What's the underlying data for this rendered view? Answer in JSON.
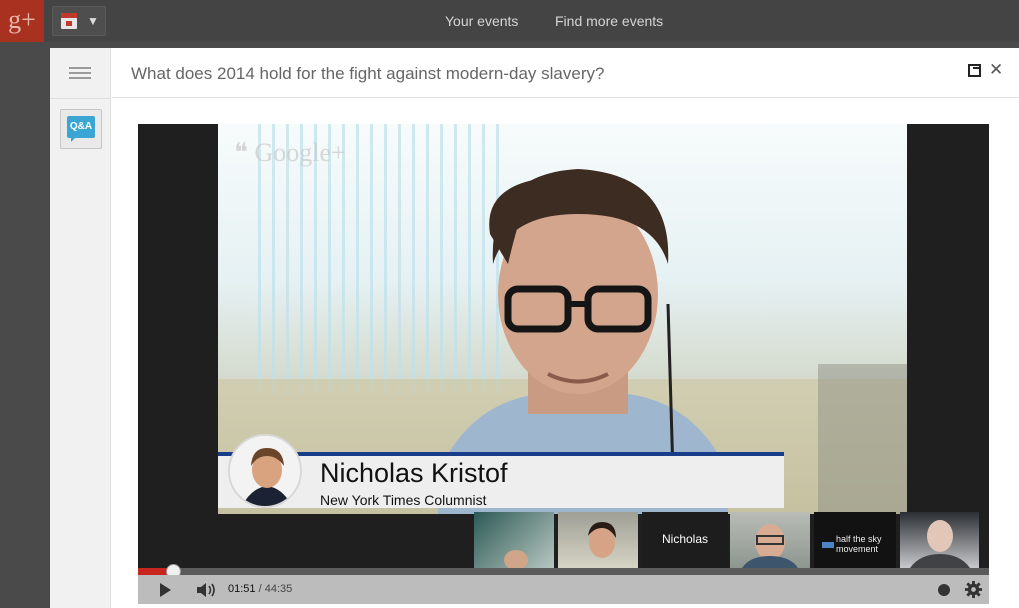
{
  "topbar": {
    "logo_text": "g+",
    "nav": [
      "Your events",
      "Find more events"
    ]
  },
  "modal": {
    "title": "What does 2014 hold for the fight against modern-day slavery?",
    "qa_label": "Q&A"
  },
  "video": {
    "watermark": "Google+",
    "lower_third": {
      "name": "Nicholas Kristof",
      "role": "New York Times Columnist"
    },
    "thumbnails": [
      {
        "label": ""
      },
      {
        "label": ""
      },
      {
        "label": "Nicholas"
      },
      {
        "label": ""
      },
      {
        "label": "half the sky movement"
      },
      {
        "label": ""
      }
    ]
  },
  "player": {
    "current_time": "01:51",
    "separator": " / ",
    "duration": "44:35",
    "progress_fraction": 0.0415
  },
  "colors": {
    "logo_bg": "#a8321f",
    "progress_red": "#c8251e",
    "lower_third_bar": "#1a3d8a",
    "qa_blue": "#3ba6d3"
  }
}
